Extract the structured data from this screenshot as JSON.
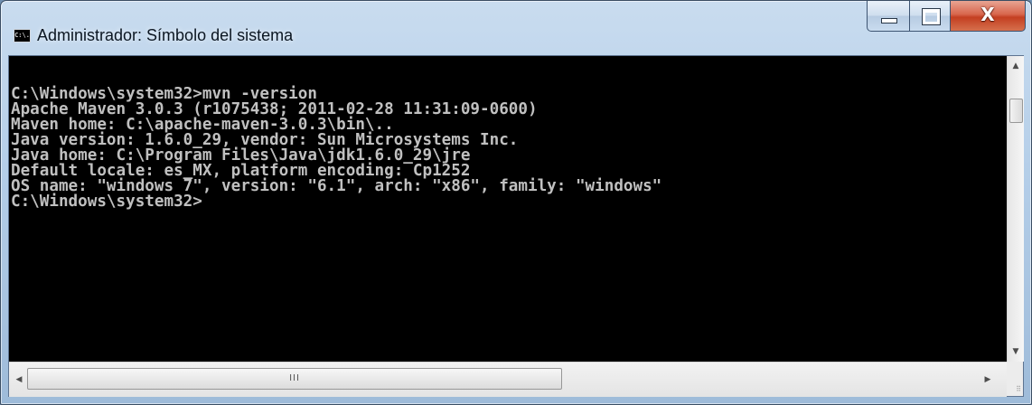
{
  "window": {
    "title": "Administrador: Símbolo del sistema",
    "icon": "console-icon",
    "icon_text": "C:\\.",
    "controls": {
      "minimize": "minimize-icon",
      "maximize": "maximize-icon",
      "close_glyph": "X"
    }
  },
  "console": {
    "text_color": "#c0c0c0",
    "background": "#000000",
    "lines": [
      "C:\\Windows\\system32>mvn -version",
      "Apache Maven 3.0.3 (r1075438; 2011-02-28 11:31:09-0600)",
      "Maven home: C:\\apache-maven-3.0.3\\bin\\..",
      "Java version: 1.6.0_29, vendor: Sun Microsystems Inc.",
      "Java home: C:\\Program Files\\Java\\jdk1.6.0_29\\jre",
      "Default locale: es_MX, platform encoding: Cp1252",
      "OS name: \"windows 7\", version: \"6.1\", arch: \"x86\", family: \"windows\"",
      "C:\\Windows\\system32>"
    ]
  },
  "scrollbars": {
    "up_arrow": "▲",
    "down_arrow": "▼",
    "left_arrow": "◀",
    "right_arrow": "▶",
    "thumb_grip": "III"
  }
}
